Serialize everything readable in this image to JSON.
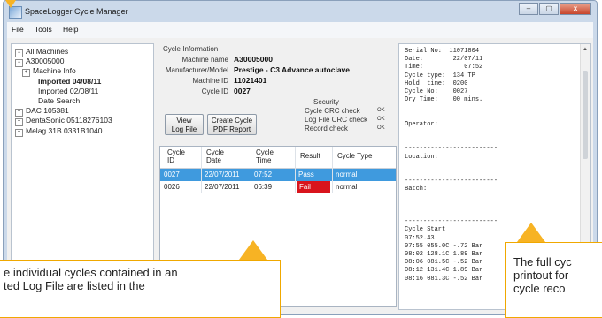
{
  "window": {
    "title": "SpaceLogger Cycle Manager",
    "buttons": [
      "–",
      "▢",
      "x"
    ]
  },
  "menu": [
    "File",
    "Tools",
    "Help"
  ],
  "tree": [
    {
      "label": "All Machines",
      "exp": "−",
      "indent": 0,
      "bold": false
    },
    {
      "label": "A30005000",
      "exp": "−",
      "indent": 0,
      "bold": false
    },
    {
      "label": "Machine Info",
      "exp": "+",
      "indent": 1,
      "bold": false
    },
    {
      "label": "Imported 04/08/11",
      "exp": "",
      "indent": 2,
      "bold": true
    },
    {
      "label": "Imported 02/08/11",
      "exp": "",
      "indent": 2,
      "bold": false
    },
    {
      "label": "Date Search",
      "exp": "",
      "indent": 2,
      "bold": false
    },
    {
      "label": "DAC 105381",
      "exp": "+",
      "indent": 0,
      "bold": false
    },
    {
      "label": "DentaSonic 05118276103",
      "exp": "+",
      "indent": 0,
      "bold": false
    },
    {
      "label": "Melag 31B 0331B1040",
      "exp": "+",
      "indent": 0,
      "bold": false
    }
  ],
  "cycle_info": {
    "heading": "Cycle Information",
    "machine_name_label": "Machine name",
    "machine_name": "A30005000",
    "manufacturer_label": "Manufacturer/Model",
    "manufacturer": "Prestige - C3 Advance autoclave",
    "machine_id_label": "Machine ID",
    "machine_id": "11021401",
    "cycle_id_label": "Cycle ID",
    "cycle_id": "0027"
  },
  "security": {
    "heading": "Security",
    "checks": [
      {
        "label": "Cycle CRC check",
        "status": "OK"
      },
      {
        "label": "Log File CRC check",
        "status": "OK"
      },
      {
        "label": "Record check",
        "status": "OK"
      }
    ]
  },
  "buttons": {
    "view_log_line1": "View",
    "view_log_line2": "Log File",
    "create_line1": "Create Cycle",
    "create_line2": "PDF Report"
  },
  "table": {
    "headers": [
      [
        "Cycle",
        "ID"
      ],
      [
        "Cycle",
        "Date"
      ],
      [
        "Cycle",
        "Time"
      ],
      [
        "Result",
        ""
      ],
      [
        "Cycle Type",
        ""
      ]
    ],
    "rows": [
      {
        "id": "0027",
        "date": "22/07/2011",
        "time": "07:52",
        "result": "Pass",
        "type": "normal",
        "selected": true
      },
      {
        "id": "0026",
        "date": "22/07/2011",
        "time": "06:39",
        "result": "Fail",
        "type": "normal",
        "selected": false
      }
    ]
  },
  "printout": {
    "text": "Serial No:  11071804\nDate:        22/07/11\nTime:           07:52\nCycle type:  134 TP\nHold  time:  0200\nCycle No:    0027\nDry Time:    00 mins.\n\n\nOperator:\n\n\n-------------------------\nLocation:\n\n\n-------------------------\nBatch:\n\n\n\n-------------------------\nCycle Start\n07:52.43\n07:55 055.0C -.72 Bar\n08:02 128.1C 1.89 Bar\n08:06 081.5C -.52 Bar\n08:12 131.4C 1.89 Bar\n08:16 081.3C -.52 Bar"
  },
  "callouts": {
    "left_line1": "e individual cycles contained in an",
    "left_line2": "ted Log File are listed in the",
    "right_line1": "The full cyc",
    "right_line2": "printout for",
    "right_line3": "cycle reco"
  }
}
